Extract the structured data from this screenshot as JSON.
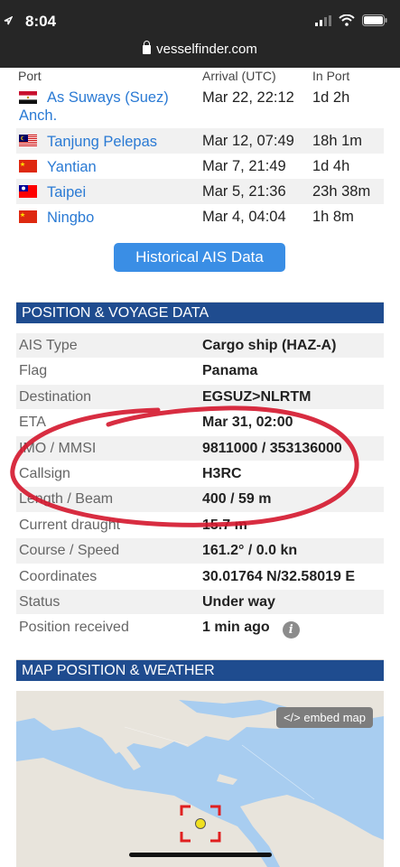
{
  "status_bar": {
    "time": "8:04"
  },
  "browser": {
    "url": "vesselfinder.com"
  },
  "port_table": {
    "headers": [
      "Port",
      "Arrival (UTC)",
      "In Port"
    ],
    "rows": [
      {
        "port": "As Suways (Suez) Anch.",
        "arrival": "Mar 22, 22:12",
        "in_port": "1d 2h"
      },
      {
        "port": "Tanjung Pelepas",
        "arrival": "Mar 12, 07:49",
        "in_port": "18h 1m"
      },
      {
        "port": "Yantian",
        "arrival": "Mar 7, 21:49",
        "in_port": "1d 4h"
      },
      {
        "port": "Taipei",
        "arrival": "Mar 5, 21:36",
        "in_port": "23h 38m"
      },
      {
        "port": "Ningbo",
        "arrival": "Mar 4, 04:04",
        "in_port": "1h 8m"
      }
    ]
  },
  "historical_button": "Historical AIS Data",
  "position_section": {
    "title": "POSITION & VOYAGE DATA",
    "rows": [
      {
        "label": "AIS Type",
        "value": "Cargo ship (HAZ-A)"
      },
      {
        "label": "Flag",
        "value": "Panama"
      },
      {
        "label": "Destination",
        "value": "EGSUZ>NLRTM"
      },
      {
        "label": "ETA",
        "value": "Mar 31, 02:00"
      },
      {
        "label": "IMO / MMSI",
        "value": "9811000 / 353136000"
      },
      {
        "label": "Callsign",
        "value": "H3RC"
      },
      {
        "label": "Length / Beam",
        "value": "400 / 59 m"
      },
      {
        "label": "Current draught",
        "value": "15.7 m"
      },
      {
        "label": "Course / Speed",
        "value": "161.2° / 0.0 kn"
      },
      {
        "label": "Coordinates",
        "value": "30.01764 N/32.58019 E"
      },
      {
        "label": "Status",
        "value": "Under way"
      },
      {
        "label": "Position received",
        "value": "1 min ago"
      }
    ]
  },
  "map_section": {
    "title": "MAP POSITION & WEATHER",
    "embed_label": "</> embed map"
  }
}
